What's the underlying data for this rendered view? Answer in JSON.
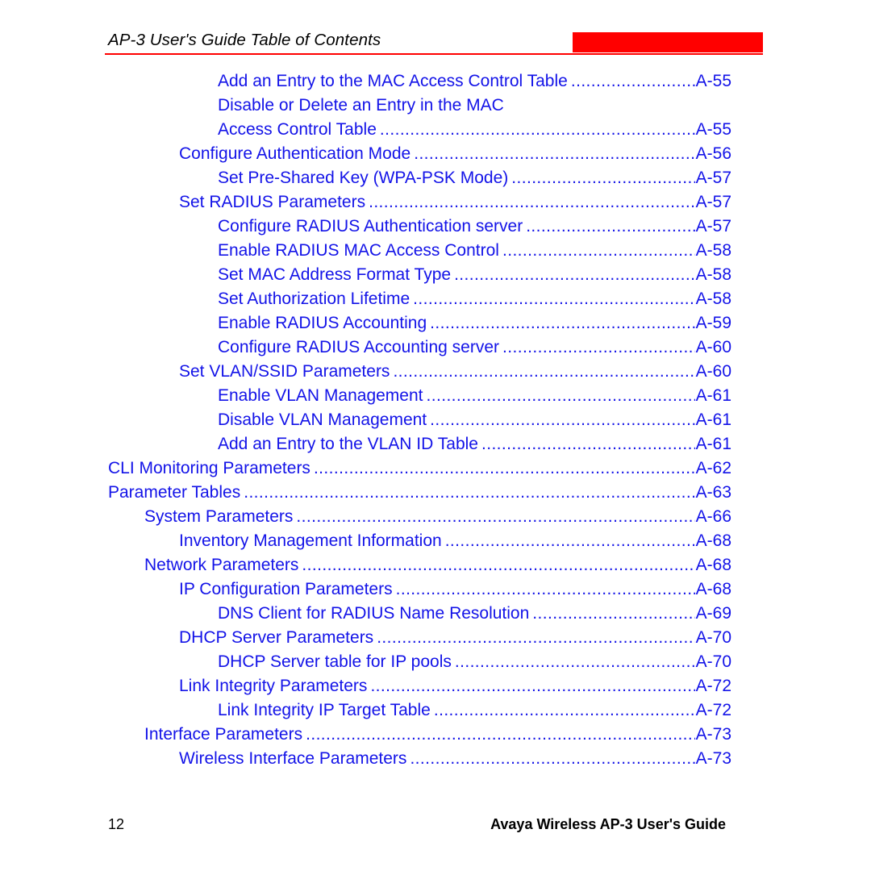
{
  "header": {
    "title": "AP-3 User's Guide Table of Contents",
    "redaction_box_color": "#ff0000",
    "rule_color": "#ff0000"
  },
  "theme": {
    "toc_text_color": "#1313e8",
    "header_text_color": "#000000",
    "footer_text_color": "#000000",
    "accent_red": "#ff0000"
  },
  "toc": {
    "entries": [
      {
        "title": "Add an Entry to the MAC Access Control Table",
        "page": "A-55",
        "level": 3
      },
      {
        "title": "Disable or Delete an Entry in the MAC",
        "page": "",
        "level": 3
      },
      {
        "title": "Access Control Table",
        "page": "A-55",
        "level": 3
      },
      {
        "title": "Configure Authentication Mode",
        "page": "A-56",
        "level": 2
      },
      {
        "title": "Set Pre-Shared Key (WPA-PSK Mode)",
        "page": "A-57",
        "level": 3
      },
      {
        "title": "Set RADIUS Parameters",
        "page": "A-57",
        "level": 2
      },
      {
        "title": "Configure RADIUS Authentication server",
        "page": "A-57",
        "level": 3
      },
      {
        "title": "Enable RADIUS MAC Access Control",
        "page": "A-58",
        "level": 3
      },
      {
        "title": "Set MAC Address Format Type",
        "page": "A-58",
        "level": 3
      },
      {
        "title": "Set Authorization Lifetime",
        "page": "A-58",
        "level": 3
      },
      {
        "title": "Enable RADIUS Accounting",
        "page": "A-59",
        "level": 3
      },
      {
        "title": "Configure RADIUS Accounting server",
        "page": "A-60",
        "level": 3
      },
      {
        "title": "Set VLAN/SSID Parameters",
        "page": "A-60",
        "level": 2
      },
      {
        "title": "Enable VLAN Management",
        "page": "A-61",
        "level": 3
      },
      {
        "title": "Disable VLAN Management",
        "page": "A-61",
        "level": 3
      },
      {
        "title": "Add an Entry to the VLAN ID Table",
        "page": "A-61",
        "level": 3
      },
      {
        "title": "CLI Monitoring Parameters",
        "page": "A-62",
        "level": 0
      },
      {
        "title": "Parameter Tables",
        "page": "A-63",
        "level": 0
      },
      {
        "title": "System Parameters",
        "page": "A-66",
        "level": 1
      },
      {
        "title": "Inventory Management Information",
        "page": "A-68",
        "level": 2
      },
      {
        "title": "Network Parameters",
        "page": "A-68",
        "level": 1
      },
      {
        "title": "IP Configuration Parameters",
        "page": "A-68",
        "level": 2
      },
      {
        "title": "DNS Client for RADIUS Name Resolution",
        "page": "A-69",
        "level": 3
      },
      {
        "title": "DHCP Server Parameters",
        "page": "A-70",
        "level": 2
      },
      {
        "title": "DHCP Server table for IP pools",
        "page": "A-70",
        "level": 3
      },
      {
        "title": "Link Integrity Parameters",
        "page": "A-72",
        "level": 2
      },
      {
        "title": "Link Integrity IP Target Table",
        "page": "A-72",
        "level": 3
      },
      {
        "title": "Interface Parameters",
        "page": "A-73",
        "level": 1
      },
      {
        "title": "Wireless Interface Parameters",
        "page": "A-73",
        "level": 2
      }
    ]
  },
  "footer": {
    "page_number": "12",
    "guide_title": "Avaya Wireless AP-3 User's Guide"
  }
}
